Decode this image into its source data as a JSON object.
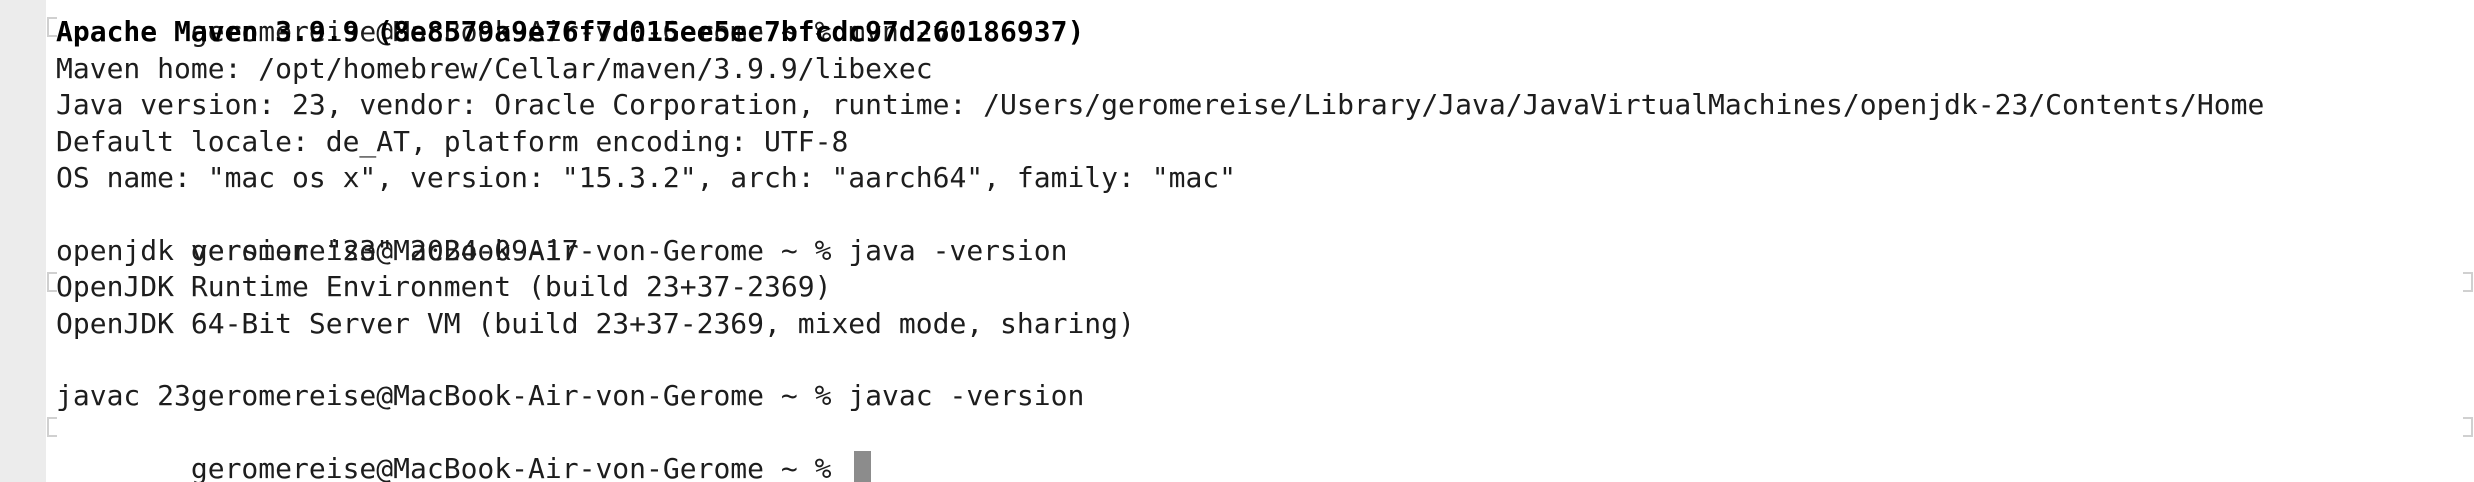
{
  "terminal": {
    "lines": [
      {
        "prompt": "geromereise@MacBook-Air-von-Gerome ~ % ",
        "command": "mvn -v"
      },
      {
        "text": "Apache Maven 3.9.9 (8e8579a9e76f7d015ee5ec7bfcdc97d260186937)"
      },
      {
        "text": "Maven home: /opt/homebrew/Cellar/maven/3.9.9/libexec"
      },
      {
        "text": "Java version: 23, vendor: Oracle Corporation, runtime: /Users/geromereise/Library/Java/JavaVirtualMachines/openjdk-23/Contents/Home"
      },
      {
        "text": "Default locale: de_AT, platform encoding: UTF-8"
      },
      {
        "text": "OS name: \"mac os x\", version: \"15.3.2\", arch: \"aarch64\", family: \"mac\""
      },
      {
        "prompt": "geromereise@MacBook-Air-von-Gerome ~ % ",
        "command": "java -version"
      },
      {
        "text": "openjdk version \"23\" 2024-09-17"
      },
      {
        "text": "OpenJDK Runtime Environment (build 23+37-2369)"
      },
      {
        "text": "OpenJDK 64-Bit Server VM (build 23+37-2369, mixed mode, sharing)"
      },
      {
        "prompt": "geromereise@MacBook-Air-von-Gerome ~ % ",
        "command": "javac -version"
      },
      {
        "text": "javac 23"
      },
      {
        "prompt": "geromereise@MacBook-Air-von-Gerome ~ % ",
        "command": ""
      }
    ],
    "colors": {
      "background": "#ffffff",
      "text": "#1d1d1d",
      "cursor": "#8c8c8c",
      "outer_background": "#ececec"
    }
  }
}
